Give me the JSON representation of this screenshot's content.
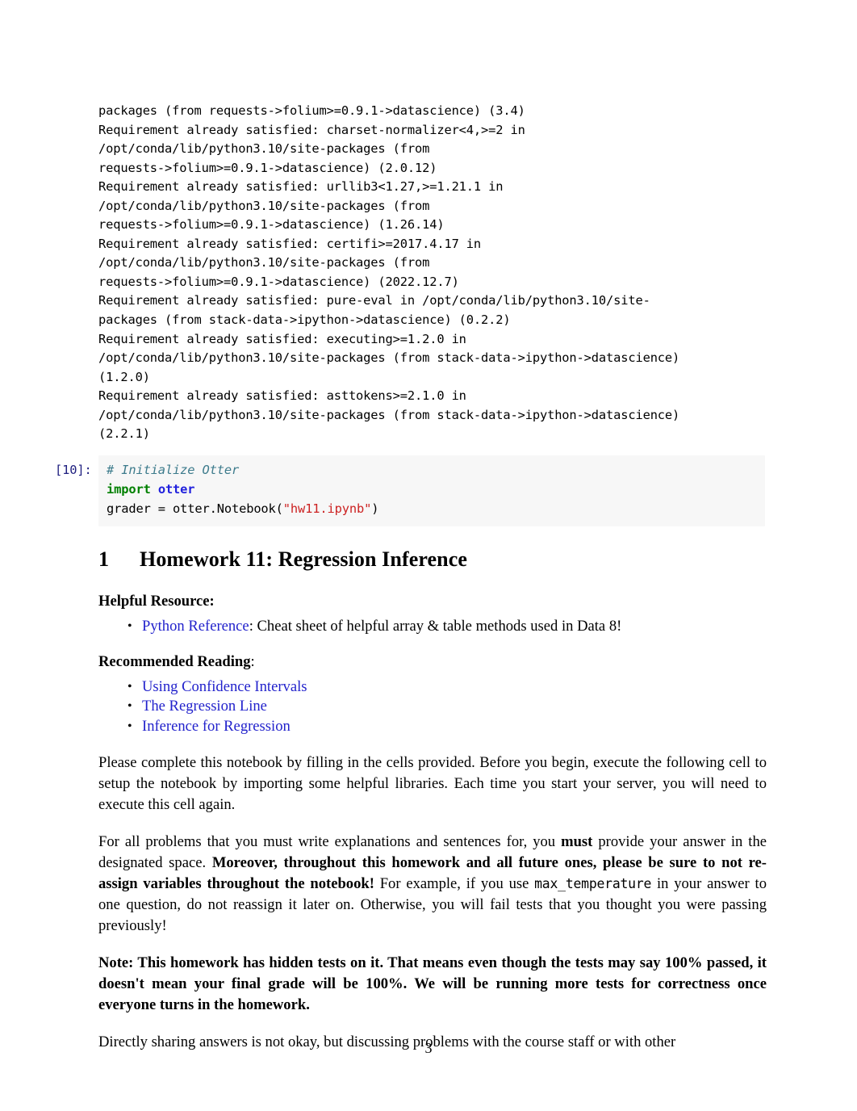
{
  "document": {
    "page_number": "3"
  },
  "output_cell": {
    "lines": [
      "packages (from requests->folium>=0.9.1->datascience) (3.4)",
      "Requirement already satisfied: charset-normalizer<4,>=2 in",
      "/opt/conda/lib/python3.10/site-packages (from",
      "requests->folium>=0.9.1->datascience) (2.0.12)",
      "Requirement already satisfied: urllib3<1.27,>=1.21.1 in",
      "/opt/conda/lib/python3.10/site-packages (from",
      "requests->folium>=0.9.1->datascience) (1.26.14)",
      "Requirement already satisfied: certifi>=2017.4.17 in",
      "/opt/conda/lib/python3.10/site-packages (from",
      "requests->folium>=0.9.1->datascience) (2022.12.7)",
      "Requirement already satisfied: pure-eval in /opt/conda/lib/python3.10/site-",
      "packages (from stack-data->ipython->datascience) (0.2.2)",
      "Requirement already satisfied: executing>=1.2.0 in",
      "/opt/conda/lib/python3.10/site-packages (from stack-data->ipython->datascience)",
      "(1.2.0)",
      "Requirement already satisfied: asttokens>=2.1.0 in",
      "/opt/conda/lib/python3.10/site-packages (from stack-data->ipython->datascience)",
      "(2.2.1)"
    ]
  },
  "code_cell": {
    "prompt": "[10]:",
    "comment": "# Initialize Otter",
    "import_keyword": "import",
    "import_module": "otter",
    "assign_lhs": "grader = otter.Notebook(",
    "assign_string": "\"hw11.ipynb\"",
    "assign_close": ")"
  },
  "markdown": {
    "section_number": "1",
    "section_title": "Homework 11: Regression Inference",
    "helpful_resource_heading": "Helpful Resource:",
    "helpful_resource_item": {
      "link": "Python Reference",
      "rest": ": Cheat sheet of helpful array & table methods used in Data 8!"
    },
    "recommended_reading_heading": "Recommended Reading",
    "recommended_reading_colon": ":",
    "recommended_reading_links": [
      "Using Confidence Intervals",
      "The Regression Line",
      "Inference for Regression"
    ],
    "paragraph_setup": "Please complete this notebook by filling in the cells provided. Before you begin, execute the following cell to setup the notebook by importing some helpful libraries. Each time you start your server, you will need to execute this cell again.",
    "paragraph_reassign": {
      "part1": "For all problems that you must write explanations and sentences for, you ",
      "bold1": "must",
      "part2": " provide your answer in the designated space. ",
      "bold2": "Moreover, throughout this homework and all future ones, please be sure to not re-assign variables throughout the notebook!",
      "part3": " For example, if you use ",
      "code1": "max_temperature",
      "part4": " in your answer to one question, do not reassign it later on. Otherwise, you will fail tests that you thought you were passing previously!"
    },
    "paragraph_note": "Note: This homework has hidden tests on it. That means even though the tests may say 100% passed, it doesn't mean your final grade will be 100%. We will be running more tests for correctness once everyone turns in the homework.",
    "paragraph_sharing": "Directly sharing answers is not okay, but discussing problems with the course staff or with other"
  },
  "colors": {
    "link": "#2222cc",
    "prompt": "#202080",
    "code_background": "#f7f7f7",
    "keyword": "#008000",
    "module": "#2020dd",
    "string": "#cc2222",
    "comment": "#3d7b8c"
  }
}
